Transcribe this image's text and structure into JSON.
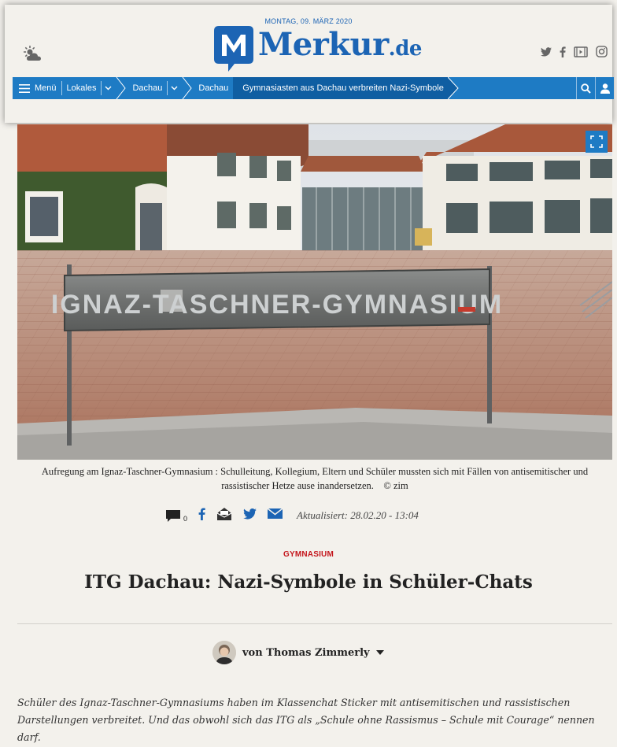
{
  "header": {
    "date": "MONTAG, 09. MÄRZ 2020",
    "logo_brand": "Merkur",
    "logo_tld": ".de",
    "weather_icon": "sun-cloud-icon",
    "social_icons": [
      "twitter-icon",
      "facebook-icon",
      "video-icon",
      "instagram-icon"
    ]
  },
  "nav": {
    "menu_label": "Menü",
    "items": [
      "Lokales",
      "Dachau",
      "Dachau"
    ],
    "current": "Gymnasiasten aus Dachau verbreiten Nazi-Symbole",
    "search_icon": "search-icon",
    "user_icon": "user-icon"
  },
  "hero": {
    "sign_text": "IGNAZ-TASCHNER-GYMNASIUM",
    "expand_icon": "expand-icon"
  },
  "caption": {
    "text": "Aufregung am Ignaz-Taschner-Gymnasium : Schulleitung, Kollegium, Eltern und Schüler mussten sich mit Fällen von antisemitischer und rassistischer Hetze ause inandersetzen.",
    "credit": "© zim"
  },
  "share": {
    "comment_count": "0",
    "updated": "Aktualisiert: 28.02.20 - 13:04"
  },
  "article": {
    "kicker": "GYMNASIUM",
    "headline": "ITG Dachau: Nazi-Symbole in Schüler-Chats",
    "author": "von Thomas Zimmerly",
    "lead": "Schüler des Ignaz-Taschner-Gymnasiums haben im Klassenchat Sticker mit antisemitischen und rassistischen Darstellungen verbreitet. Und das obwohl sich das ITG als „Schule ohne Rassismus – Schule mit Courage“ nennen darf."
  },
  "colors": {
    "brand_blue": "#1c64b4",
    "nav_blue": "#1e7bc4",
    "kicker_red": "#c4161c",
    "background": "#f3f1ec"
  }
}
